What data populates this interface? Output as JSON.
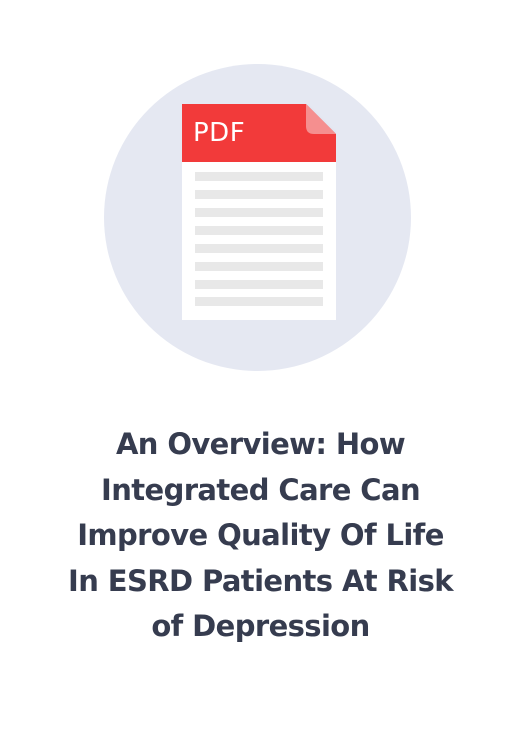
{
  "document_card": {
    "icon": {
      "name": "pdf-document-icon",
      "badge_text": "PDF",
      "colors": {
        "circle_background": "#e5e8f2",
        "badge_red": "#f23a3a",
        "folded_corner": "#f58f8f",
        "page": "#ffffff",
        "text_lines": "#e8e8e8"
      }
    },
    "title_lines": [
      "An Overview: How",
      "Integrated Care Can",
      "Improve Quality Of Life",
      "In ESRD Patients At Risk",
      "of Depression"
    ],
    "title_color": "#363c4f"
  }
}
